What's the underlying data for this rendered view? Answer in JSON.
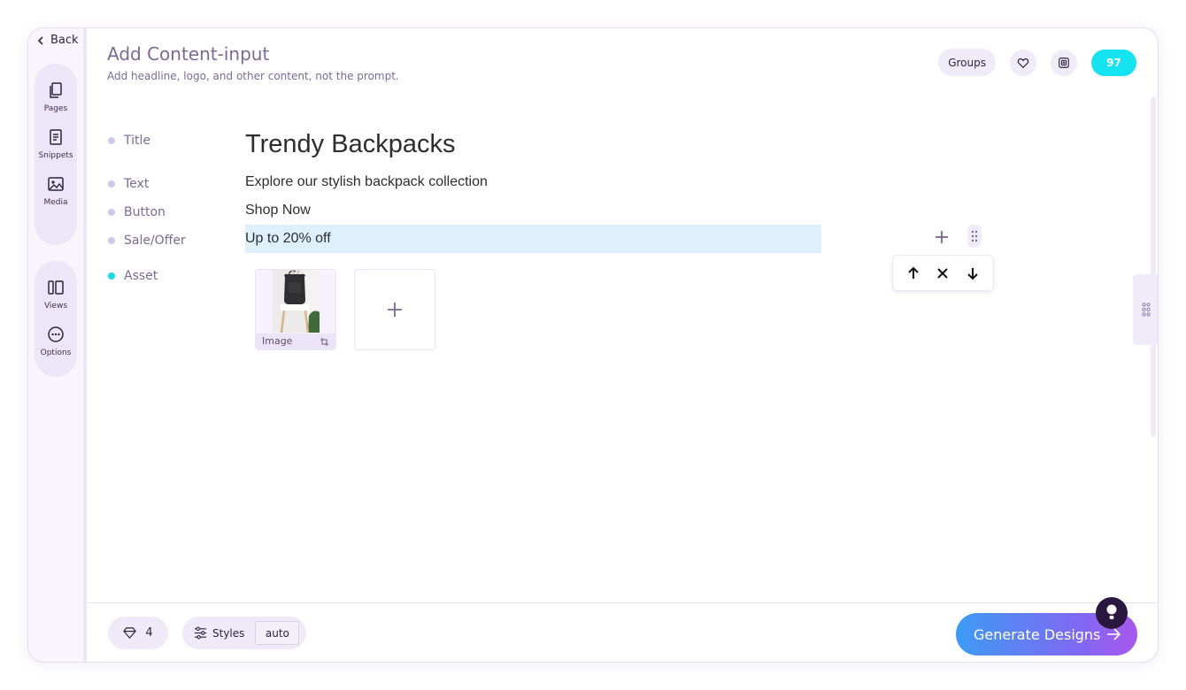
{
  "nav": {
    "back_label": "Back",
    "items": [
      {
        "label": "Pages",
        "icon": "pages-icon"
      },
      {
        "label": "Snippets",
        "icon": "snippets-icon"
      },
      {
        "label": "Media",
        "icon": "media-icon"
      },
      {
        "label": "Views",
        "icon": "views-icon"
      },
      {
        "label": "Options",
        "icon": "options-icon"
      }
    ]
  },
  "header": {
    "title": "Add Content-input",
    "subtitle": "Add headline, logo, and other content, not the prompt.",
    "groups_label": "Groups",
    "credits": "97"
  },
  "fields": [
    {
      "label": "Title"
    },
    {
      "label": "Text"
    },
    {
      "label": "Button"
    },
    {
      "label": "Sale/Offer"
    },
    {
      "label": "Asset"
    }
  ],
  "content": {
    "title": "Trendy Backpacks",
    "text": "Explore our stylish backpack collection",
    "button": "Shop Now",
    "sale": "Up to 20% off"
  },
  "assets": [
    {
      "caption": "Image"
    }
  ],
  "footer": {
    "gems_count": "4",
    "styles_label": "Styles",
    "styles_value": "auto",
    "generate_label": "Generate Designs"
  },
  "colors": {
    "accent_cyan": "#16e3f0",
    "label_purple": "#7a6a97",
    "highlight": "#dff0fd",
    "gradient_start": "#3d9bf5",
    "gradient_end": "#a857ee"
  }
}
